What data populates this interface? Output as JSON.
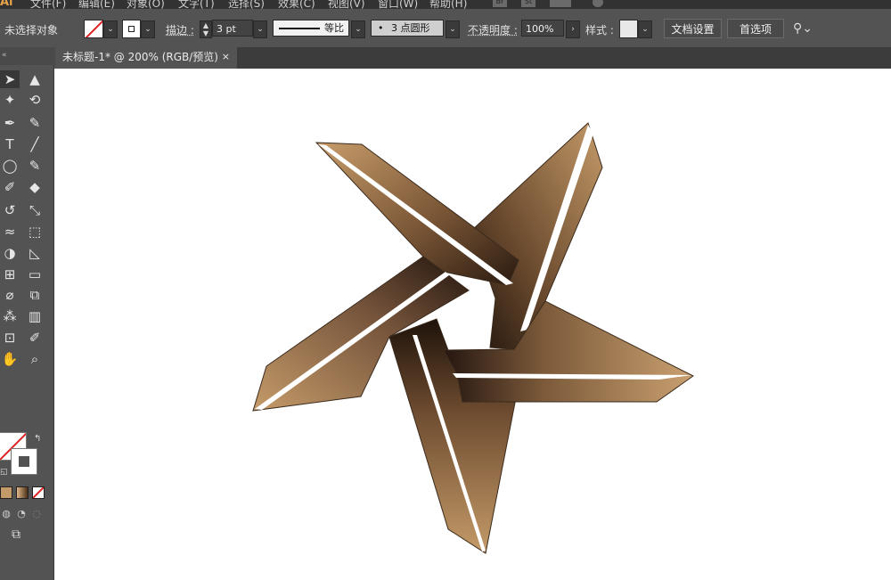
{
  "menubar": {
    "app_logo": "Ai",
    "items": [
      "文件(F)",
      "编辑(E)",
      "对象(O)",
      "文字(T)",
      "选择(S)",
      "效果(C)",
      "视图(V)",
      "窗口(W)",
      "帮助(H)"
    ],
    "bridge_label": "Br",
    "stock_label": "St"
  },
  "control_bar": {
    "selection_status": "未选择对象",
    "stroke_label": "描边 :",
    "stroke_weight": "3 pt",
    "stroke_profile": "等比",
    "brush": "3 点圆形",
    "opacity_label": "不透明度 :",
    "opacity_value": "100%",
    "style_label": "样式 :",
    "doc_setup_button": "文档设置",
    "preferences_button": "首选项"
  },
  "document_tab": {
    "title": "未标题-1* @ 200% (RGB/预览)",
    "close": "×"
  },
  "toolbar": {
    "tools": [
      {
        "name": "selection-tool-icon",
        "glyph": "➤"
      },
      {
        "name": "direct-selection-tool-icon",
        "glyph": "▲"
      },
      {
        "name": "magic-wand-tool-icon",
        "glyph": "✦"
      },
      {
        "name": "lasso-tool-icon",
        "glyph": "⟲"
      },
      {
        "name": "pen-tool-icon",
        "glyph": "✒"
      },
      {
        "name": "curvature-tool-icon",
        "glyph": "✎"
      },
      {
        "name": "type-tool-icon",
        "glyph": "T"
      },
      {
        "name": "line-tool-icon",
        "glyph": "╱"
      },
      {
        "name": "ellipse-tool-icon",
        "glyph": "◯"
      },
      {
        "name": "paintbrush-tool-icon",
        "glyph": "✎"
      },
      {
        "name": "shaper-tool-icon",
        "glyph": "✐"
      },
      {
        "name": "eraser-tool-icon",
        "glyph": "◆"
      },
      {
        "name": "rotate-tool-icon",
        "glyph": "↺"
      },
      {
        "name": "scale-tool-icon",
        "glyph": "⤡"
      },
      {
        "name": "warp-tool-icon",
        "glyph": "≈"
      },
      {
        "name": "free-transform-tool-icon",
        "glyph": "⬚"
      },
      {
        "name": "shape-builder-tool-icon",
        "glyph": "◑"
      },
      {
        "name": "perspective-grid-tool-icon",
        "glyph": "◺"
      },
      {
        "name": "mesh-tool-icon",
        "glyph": "⊞"
      },
      {
        "name": "gradient-tool-icon",
        "glyph": "▭"
      },
      {
        "name": "eyedropper-tool-icon",
        "glyph": "⌀"
      },
      {
        "name": "blend-tool-icon",
        "glyph": "⧉"
      },
      {
        "name": "symbol-sprayer-tool-icon",
        "glyph": "⁂"
      },
      {
        "name": "column-graph-tool-icon",
        "glyph": "▥"
      },
      {
        "name": "artboard-tool-icon",
        "glyph": "⊡"
      },
      {
        "name": "slice-tool-icon",
        "glyph": "✐"
      },
      {
        "name": "hand-tool-icon",
        "glyph": "✋"
      },
      {
        "name": "zoom-tool-icon",
        "glyph": "⌕"
      }
    ]
  },
  "colors": {
    "ui_dark": "#323232",
    "ui_panel": "#535353",
    "star_light": "#c49a68",
    "star_mid": "#8a6440",
    "star_dark": "#2a1a10",
    "highlight": "#ffffff",
    "none_red": "#d22222"
  }
}
